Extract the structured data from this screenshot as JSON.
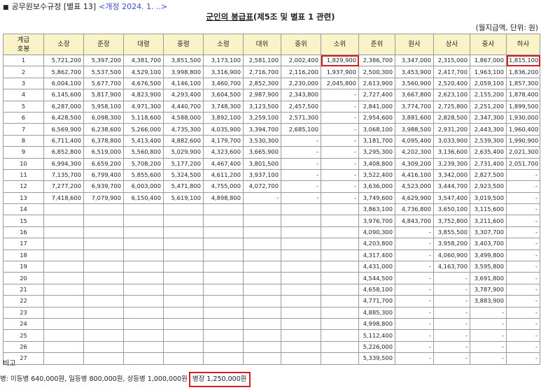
{
  "header": {
    "bullet": "■",
    "regulation": "공무원보수규정 [별표 13]",
    "revision": "<개정 2024. 1. ..>",
    "title_main": "군인의 봉급표",
    "title_rest": "(제5조 및 별표 1 관련)",
    "unit": "(월지급액, 단위: 원)"
  },
  "table": {
    "grade_header": [
      "계급",
      "호봉"
    ],
    "ranks": [
      "소장",
      "준장",
      "대령",
      "중령",
      "소령",
      "대위",
      "중위",
      "소위",
      "준위",
      "원사",
      "상사",
      "중사",
      "하사"
    ],
    "rows": [
      {
        "g": "1",
        "v": [
          "5,721,200",
          "5,397,200",
          "4,381,700",
          "3,851,500",
          "3,173,100",
          "2,581,100",
          "2,002,400",
          "1,829,900",
          "2,386,700",
          "3,347,000",
          "2,315,000",
          "1,867,000",
          "1,815,100"
        ]
      },
      {
        "g": "2",
        "v": [
          "5,862,700",
          "5,537,500",
          "4,529,100",
          "3,998,800",
          "3,316,900",
          "2,716,700",
          "2,116,200",
          "1,937,900",
          "2,500,300",
          "3,453,900",
          "2,417,700",
          "1,963,100",
          "1,836,200"
        ]
      },
      {
        "g": "3",
        "v": [
          "6,004,100",
          "5,677,700",
          "4,676,500",
          "4,146,100",
          "3,460,700",
          "2,852,300",
          "2,230,000",
          "2,045,800",
          "2,613,900",
          "3,560,900",
          "2,520,400",
          "2,059,100",
          "1,857,300"
        ]
      },
      {
        "g": "4",
        "v": [
          "6,145,600",
          "5,817,900",
          "4,823,900",
          "4,293,400",
          "3,604,500",
          "2,987,900",
          "2,343,800",
          "-",
          "2,727,400",
          "3,667,800",
          "2,623,100",
          "2,155,200",
          "1,878,400"
        ]
      },
      {
        "g": "5",
        "v": [
          "6,287,000",
          "5,958,100",
          "4,971,300",
          "4,440,700",
          "3,748,300",
          "3,123,500",
          "2,457,500",
          "-",
          "2,841,000",
          "3,774,700",
          "2,725,800",
          "2,251,200",
          "1,899,500"
        ]
      },
      {
        "g": "6",
        "v": [
          "6,428,500",
          "6,098,300",
          "5,118,600",
          "4,588,000",
          "3,892,100",
          "3,259,100",
          "2,571,300",
          "-",
          "2,954,600",
          "3,881,600",
          "2,828,500",
          "2,347,300",
          "1,930,000"
        ]
      },
      {
        "g": "7",
        "v": [
          "6,569,900",
          "6,238,600",
          "5,266,000",
          "4,735,300",
          "4,035,900",
          "3,394,700",
          "2,685,100",
          "-",
          "3,068,100",
          "3,988,500",
          "2,931,200",
          "2,443,300",
          "1,960,400"
        ]
      },
      {
        "g": "8",
        "v": [
          "6,711,400",
          "6,378,800",
          "5,413,400",
          "4,882,600",
          "4,179,700",
          "3,530,300",
          "-",
          "-",
          "3,181,700",
          "4,095,400",
          "3,033,900",
          "2,539,300",
          "1,990,900"
        ]
      },
      {
        "g": "9",
        "v": [
          "6,852,800",
          "6,519,000",
          "5,560,800",
          "5,029,900",
          "4,323,600",
          "3,665,900",
          "-",
          "-",
          "3,295,300",
          "4,202,300",
          "3,136,600",
          "2,635,400",
          "2,021,300"
        ]
      },
      {
        "g": "10",
        "v": [
          "6,994,300",
          "6,659,200",
          "5,708,200",
          "5,177,200",
          "4,467,400",
          "3,801,500",
          "-",
          "-",
          "3,408,800",
          "4,309,200",
          "3,239,300",
          "2,731,400",
          "2,051,700"
        ]
      },
      {
        "g": "11",
        "v": [
          "7,135,700",
          "6,799,400",
          "5,855,600",
          "5,324,500",
          "4,611,200",
          "3,937,100",
          "-",
          "-",
          "3,522,400",
          "4,416,100",
          "3,342,000",
          "2,827,500",
          "-"
        ]
      },
      {
        "g": "12",
        "v": [
          "7,277,200",
          "6,939,700",
          "6,003,000",
          "5,471,800",
          "4,755,000",
          "4,072,700",
          "-",
          "-",
          "3,636,000",
          "4,523,000",
          "3,444,700",
          "2,923,500",
          "-"
        ]
      },
      {
        "g": "13",
        "v": [
          "7,418,600",
          "7,079,900",
          "6,150,400",
          "5,619,100",
          "4,898,800",
          "-",
          "-",
          "-",
          "3,749,600",
          "4,629,900",
          "3,547,400",
          "3,019,500",
          "-"
        ]
      },
      {
        "g": "14",
        "v": [
          "",
          "",
          "",
          "",
          "",
          "",
          "",
          "",
          "3,863,100",
          "4,736,800",
          "3,650,100",
          "3,115,600",
          "-"
        ]
      },
      {
        "g": "15",
        "v": [
          "",
          "",
          "",
          "",
          "",
          "",
          "",
          "",
          "3,976,700",
          "4,843,700",
          "3,752,800",
          "3,211,600",
          "-"
        ]
      },
      {
        "g": "16",
        "v": [
          "",
          "",
          "",
          "",
          "",
          "",
          "",
          "",
          "4,090,300",
          "-",
          "3,855,500",
          "3,307,700",
          "-"
        ]
      },
      {
        "g": "17",
        "v": [
          "",
          "",
          "",
          "",
          "",
          "",
          "",
          "",
          "4,203,800",
          "-",
          "3,958,200",
          "3,403,700",
          "-"
        ]
      },
      {
        "g": "18",
        "v": [
          "",
          "",
          "",
          "",
          "",
          "",
          "",
          "",
          "4,317,400",
          "-",
          "4,060,900",
          "3,499,800",
          "-"
        ]
      },
      {
        "g": "19",
        "v": [
          "",
          "",
          "",
          "",
          "",
          "",
          "",
          "",
          "4,431,000",
          "-",
          "4,163,700",
          "3,595,800",
          "-"
        ]
      },
      {
        "g": "20",
        "v": [
          "",
          "",
          "",
          "",
          "",
          "",
          "",
          "",
          "4,544,500",
          "-",
          "-",
          "3,691,800",
          "-"
        ]
      },
      {
        "g": "21",
        "v": [
          "",
          "",
          "",
          "",
          "",
          "",
          "",
          "",
          "4,658,100",
          "-",
          "-",
          "3,787,900",
          "-"
        ]
      },
      {
        "g": "22",
        "v": [
          "",
          "",
          "",
          "",
          "",
          "",
          "",
          "",
          "4,771,700",
          "-",
          "-",
          "3,883,900",
          "-"
        ]
      },
      {
        "g": "23",
        "v": [
          "",
          "",
          "",
          "",
          "",
          "",
          "",
          "",
          "4,885,300",
          "-",
          "-",
          "-",
          "-"
        ]
      },
      {
        "g": "24",
        "v": [
          "",
          "",
          "",
          "",
          "",
          "",
          "",
          "",
          "4,998,800",
          "-",
          "-",
          "-",
          "-"
        ]
      },
      {
        "g": "25",
        "v": [
          "",
          "",
          "",
          "",
          "",
          "",
          "",
          "",
          "5,112,400",
          "-",
          "-",
          "-",
          "-"
        ]
      },
      {
        "g": "26",
        "v": [
          "",
          "",
          "",
          "",
          "",
          "",
          "",
          "",
          "5,226,000",
          "-",
          "-",
          "-",
          "-"
        ]
      },
      {
        "g": "27",
        "v": [
          "",
          "",
          "",
          "",
          "",
          "",
          "",
          "",
          "5,339,500",
          "-",
          "-",
          "-",
          "-"
        ]
      }
    ],
    "highlighted_cells": [
      [
        0,
        7
      ],
      [
        0,
        12
      ]
    ]
  },
  "remark": {
    "label": "비고",
    "note_text": "병: 이등병  640,000원, 일등병  800,000원, 상등병  1,000,000원",
    "note_highlight": "병장  1,250,000원"
  },
  "colors": {
    "header_bg": "#fbf3c8",
    "highlight": "#d11f1f",
    "revision_link": "#3b4cc8"
  }
}
